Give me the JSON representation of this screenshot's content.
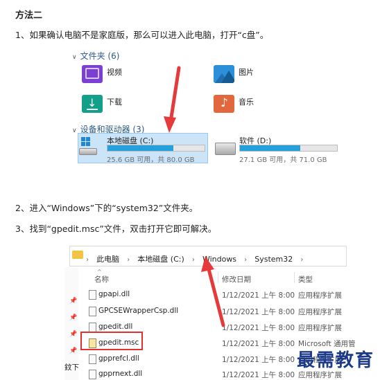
{
  "heading": "方法二",
  "steps": {
    "s1": "1、如果确认电脑不是家庭版，那么可以进入此电脑，打开“c盘”。",
    "s2": "2、进入“Windows”下的“system32”文件夹。",
    "s3": "3、找到“gpedit.msc”文件，双击打开它即可解决。"
  },
  "explorer1": {
    "folders_section": "文件夹 (6)",
    "folders": [
      {
        "label": "视频",
        "icon": "video-folder-icon",
        "color": "#7b3fd1"
      },
      {
        "label": "图片",
        "icon": "pictures-folder-icon",
        "color": "#2c8fd9"
      },
      {
        "label": "下载",
        "icon": "downloads-folder-icon",
        "color": "#13a08a"
      },
      {
        "label": "音乐",
        "icon": "music-folder-icon",
        "color": "#e2673c"
      }
    ],
    "drives_section": "设备和驱动器 (3)",
    "drives": [
      {
        "name": "本地磁盘 (C:)",
        "info": "25.6 GB 可用，共 80.0 GB",
        "used_fraction": 0.68
      },
      {
        "name": "软件 (D:)",
        "info": "27.1 GB 可用，共 71.0 GB",
        "used_fraction": 0.62
      }
    ]
  },
  "explorer2": {
    "breadcrumb": [
      "此电脑",
      "本地磁盘 (C:)",
      "Windows",
      "System32"
    ],
    "columns": {
      "name": "名称",
      "date": "修改日期",
      "type": "类型"
    },
    "files": [
      {
        "name": "gpapi.dll",
        "date": "1/12/2021 上午 8:00",
        "type": "应用程序扩展"
      },
      {
        "name": "GPCSEWrapperCsp.dll",
        "date": "1/12/2021 上午 8:00",
        "type": "应用程序扩展"
      },
      {
        "name": "gpedit.dll",
        "date": "1/12/2021 上午 8:00",
        "type": "应用程序扩展"
      },
      {
        "name": "gpedit.msc",
        "date": "1/12/2021 上午 8:00",
        "type": "Microsoft 通用管"
      },
      {
        "name": "gpprefcl.dll",
        "date": "1/12/2021 上午 8:00",
        "type": "应用程序扩展"
      },
      {
        "name": "gpprnext.dll",
        "date": "1/12/2021 上午 8:00",
        "type": "应用程序扩展"
      }
    ],
    "side_fragment": "鈫下"
  },
  "watermark": "最需教育",
  "colors": {
    "arrow": "#e63a3a",
    "highlight_box": "#e03030",
    "section_title": "#2a5a86",
    "drive_fill": "#26a0da"
  }
}
